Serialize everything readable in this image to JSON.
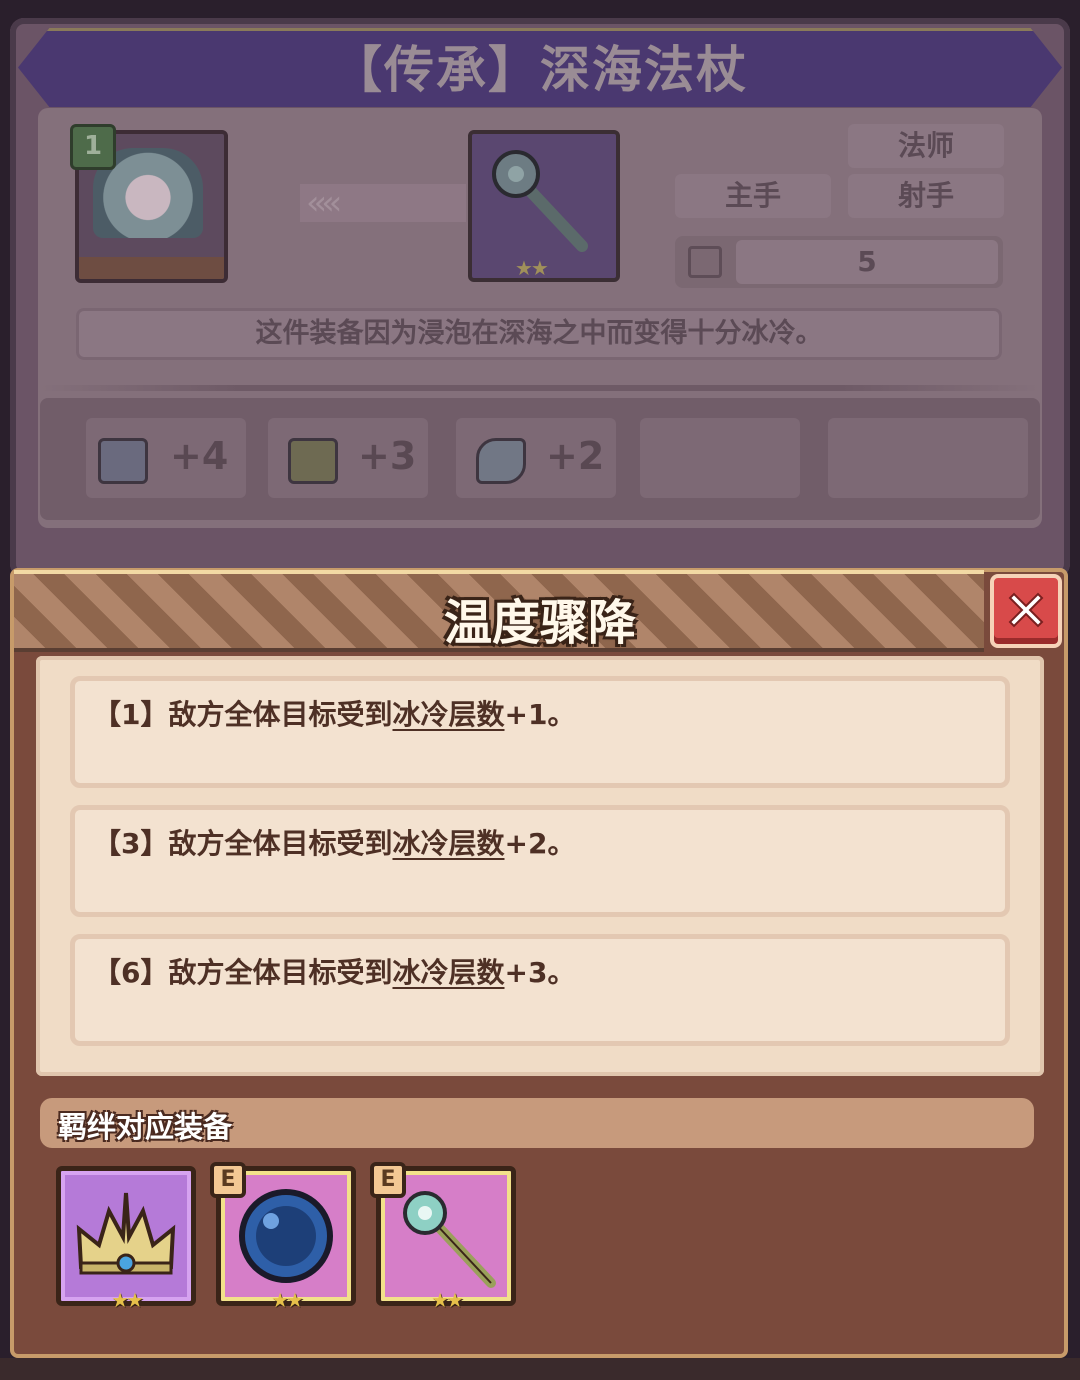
{
  "equipment": {
    "title": "【传承】深海法杖",
    "hero_level": "1",
    "tags": {
      "class": "法师",
      "slot": "主手",
      "class2": "射手"
    },
    "count": "5",
    "description": "这件装备因为浸泡在深海之中而变得十分冰冷。",
    "stats": [
      {
        "icon": "book-icon",
        "value": "+4"
      },
      {
        "icon": "scroll-icon",
        "value": "+3"
      },
      {
        "icon": "crystal-icon",
        "value": "+2"
      }
    ]
  },
  "popup": {
    "title": "温度骤降",
    "effects": [
      {
        "prefix": "【1】敌方全体目标受到",
        "keyword": "冰冷层数",
        "suffix": "+1。"
      },
      {
        "prefix": "【3】敌方全体目标受到",
        "keyword": "冰冷层数",
        "suffix": "+2。"
      },
      {
        "prefix": "【6】敌方全体目标受到",
        "keyword": "冰冷层数",
        "suffix": "+3。"
      }
    ],
    "bond_label": "羁绊对应装备",
    "bond_items": [
      {
        "icon": "crown-icon",
        "stars": "★★",
        "badge": ""
      },
      {
        "icon": "orb-icon",
        "stars": "★★",
        "badge": "E"
      },
      {
        "icon": "staff-icon",
        "stars": "★★",
        "badge": "E"
      }
    ]
  },
  "colors": {
    "popup_frame": "#7a4a3c",
    "card_bg": "#f3e2d0",
    "text_dark": "#4e3025",
    "close_red": "#d84a4a"
  }
}
